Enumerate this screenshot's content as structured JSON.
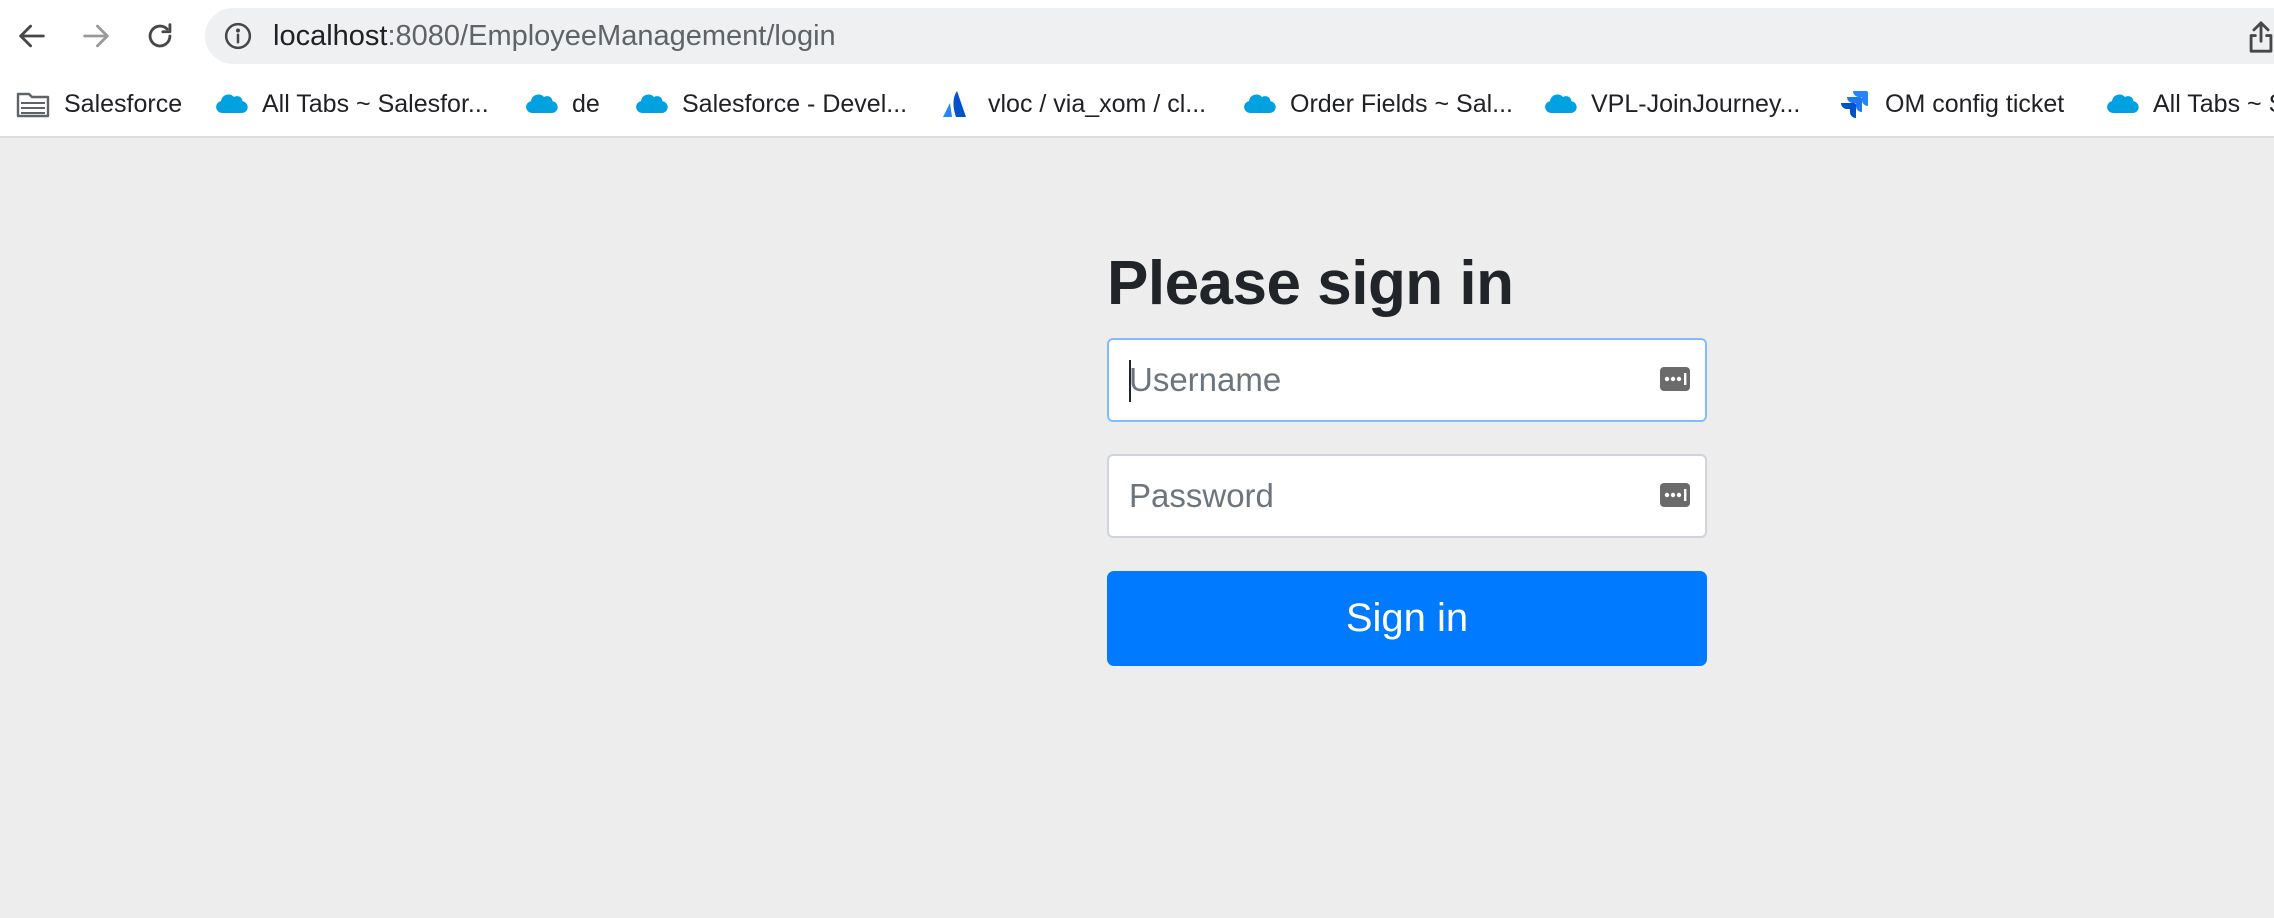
{
  "browser": {
    "url_host": "localhost",
    "url_path": ":8080/EmployeeManagement/login",
    "bookmarks": [
      {
        "label": "Salesforce",
        "icon": "folder-icon"
      },
      {
        "label": "All Tabs ~ Salesfor...",
        "icon": "salesforce-cloud-icon"
      },
      {
        "label": "de",
        "icon": "salesforce-cloud-icon"
      },
      {
        "label": "Salesforce - Devel...",
        "icon": "salesforce-cloud-icon"
      },
      {
        "label": "vloc / via_xom / cl...",
        "icon": "atlassian-icon"
      },
      {
        "label": "Order Fields ~ Sal...",
        "icon": "salesforce-cloud-icon"
      },
      {
        "label": "VPL-JoinJourney...",
        "icon": "salesforce-cloud-icon"
      },
      {
        "label": "OM config ticket",
        "icon": "jira-icon"
      },
      {
        "label": "All Tabs ~ S",
        "icon": "salesforce-cloud-icon"
      }
    ]
  },
  "login": {
    "title": "Please sign in",
    "username_placeholder": "Username",
    "password_placeholder": "Password",
    "signin_label": "Sign in"
  },
  "colors": {
    "primary": "#007bff",
    "page_background": "#ededed",
    "salesforce_blue": "#00a1e0"
  }
}
